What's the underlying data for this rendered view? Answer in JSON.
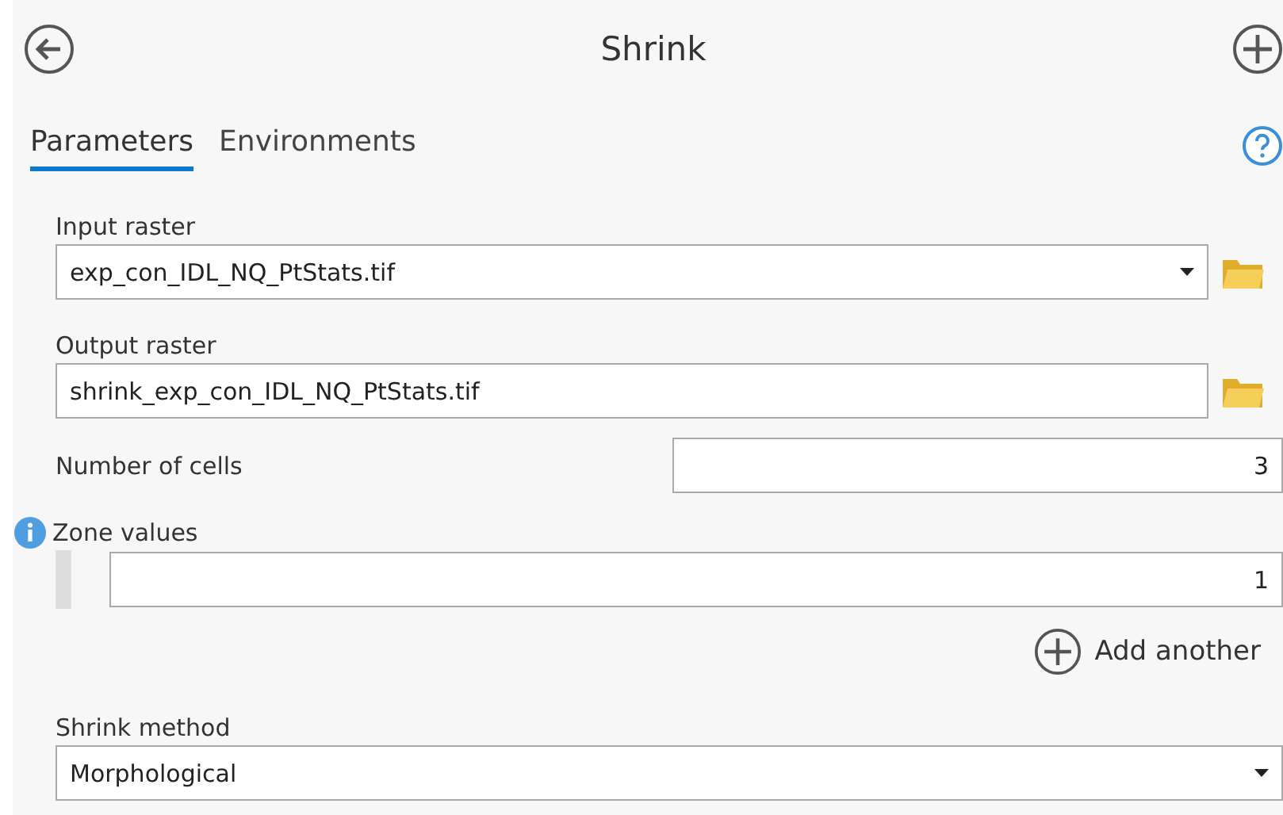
{
  "header": {
    "title": "Shrink"
  },
  "tabs": [
    {
      "label": "Parameters",
      "selected": true
    },
    {
      "label": "Environments",
      "selected": false
    }
  ],
  "parameters": [
    {
      "kind": "dropdown",
      "label": "Input raster",
      "value": "exp_con_IDL_NQ_PtStats.tif",
      "browse": true
    },
    {
      "kind": "text",
      "label": "Output raster",
      "value": "shrink_exp_con_IDL_NQ_PtStats.tif",
      "browse": true
    },
    {
      "kind": "number",
      "label": "Number of cells",
      "value": "3"
    },
    {
      "kind": "multivalue",
      "label": "Zone values",
      "info": true,
      "values": [
        "1"
      ],
      "add_label": "Add another"
    },
    {
      "kind": "dropdown",
      "label": "Shrink method",
      "value": "Morphological",
      "browse": false
    }
  ]
}
